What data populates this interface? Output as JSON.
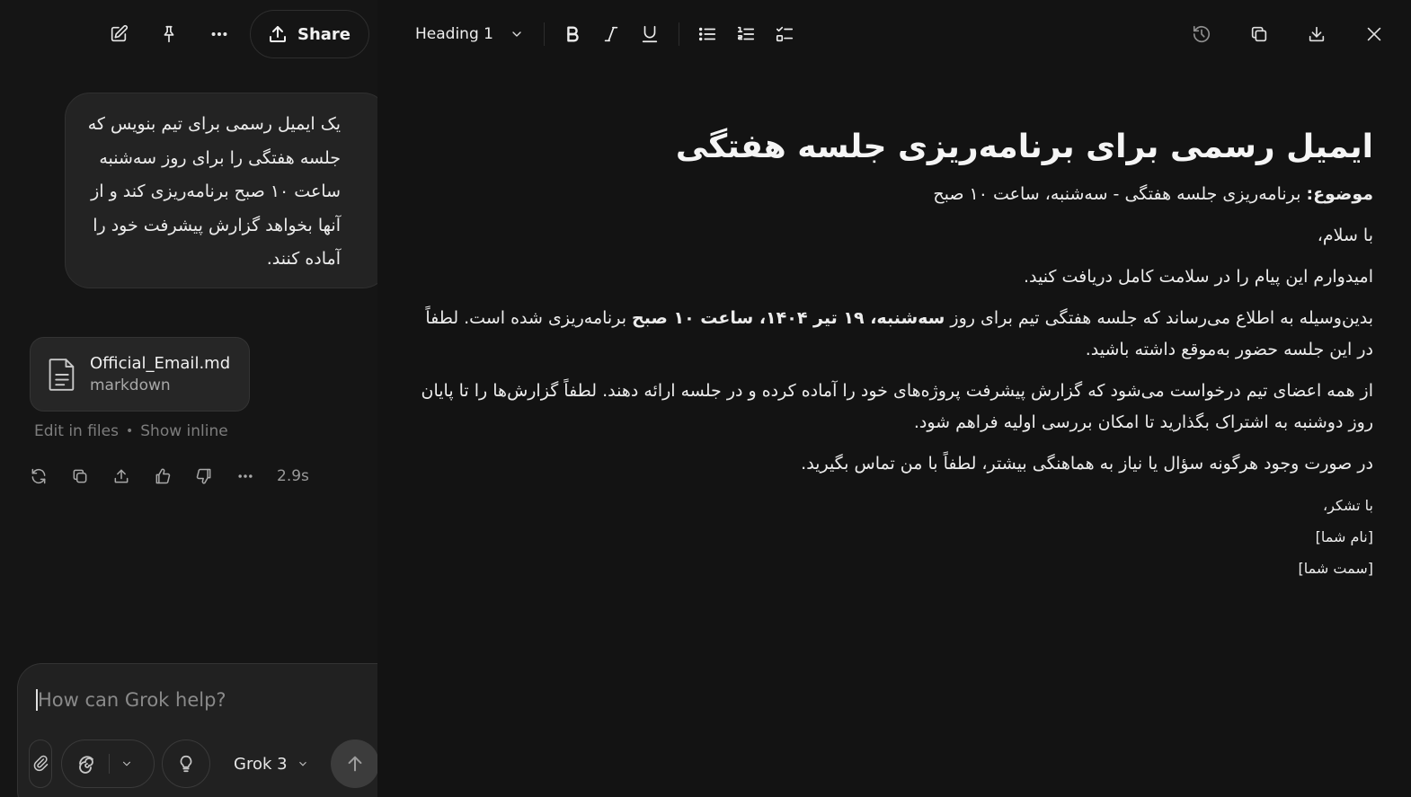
{
  "chat": {
    "share_label": "Share",
    "user_message": "یک ایمیل رسمی برای تیم بنویس که جلسه هفتگی را برای روز سه‌شنبه ساعت ۱۰ صبح برنامه‌ریزی کند و از آنها بخواهد گزارش پیشرفت خود را آماده کنند.",
    "file": {
      "name": "Official_Email.md",
      "type": "markdown"
    },
    "links": {
      "edit": "Edit in files",
      "separator": "•",
      "inline": "Show inline"
    },
    "response_time": "2.9s",
    "composer": {
      "placeholder": "How can Grok help?",
      "model": "Grok 3"
    }
  },
  "editor": {
    "block_type": "Heading 1",
    "document": {
      "title": "ایمیل رسمی برای برنامه‌ریزی جلسه هفتگی",
      "subject_label": "موضوع:",
      "subject_text": " برنامه‌ریزی جلسه هفتگی - سه‌شنبه، ساعت ۱۰ صبح",
      "greeting": "با سلام،",
      "wish": "امیدوارم این پیام را در سلامت کامل دریافت کنید.",
      "p1_before": "بدین‌وسیله به اطلاع می‌رساند که جلسه هفتگی تیم برای روز ",
      "p1_bold": "سه‌شنبه، ۱۹ تیر ۱۴۰۴، ساعت ۱۰ صبح",
      "p1_after": " برنامه‌ریزی شده است. لطفاً در این جلسه حضور به‌موقع داشته باشید.",
      "p2": "از همه اعضای تیم درخواست می‌شود که گزارش پیشرفت پروژه‌های خود را آماده کرده و در جلسه ارائه دهند. لطفاً گزارش‌ها را تا پایان روز دوشنبه به اشتراک بگذارید تا امکان بررسی اولیه فراهم شود.",
      "p3": "در صورت وجود هرگونه سؤال یا نیاز به هماهنگی بیشتر، لطفاً با من تماس بگیرید.",
      "closing": "با تشکر،",
      "name_placeholder": "[نام شما]",
      "title_placeholder": "[سمت شما]"
    }
  }
}
